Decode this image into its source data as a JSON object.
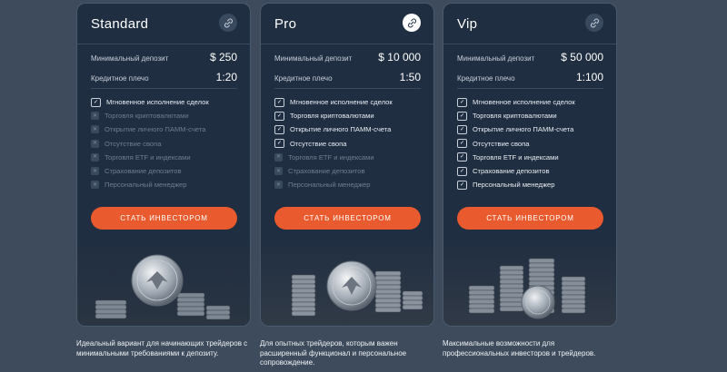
{
  "colors": {
    "accent": "#e95a2e",
    "card": "#1f2e41",
    "page": "#3d4b5c"
  },
  "plans": [
    {
      "name": "Standard",
      "badge_icon": "link-icon",
      "min_deposit_label": "Минимальный депозит",
      "min_deposit": "$ 250",
      "leverage_label": "Кредитное плечо",
      "leverage": "1:20",
      "features": [
        {
          "label": "Мгновенное исполнение сделок",
          "included": true
        },
        {
          "label": "Торговля криптовалютами",
          "included": false
        },
        {
          "label": "Открытие личного ПАММ-счета",
          "included": false
        },
        {
          "label": "Отсутствие свопа",
          "included": false
        },
        {
          "label": "Торговля ETF и индексами",
          "included": false
        },
        {
          "label": "Страхование депозитов",
          "included": false
        },
        {
          "label": "Персональный менеджер",
          "included": false
        }
      ],
      "cta": "СТАТЬ ИНВЕСТОРОМ",
      "description": "Идеальный вариант для начинающих трейдеров с минимальными требованиями к депозиту."
    },
    {
      "name": "Pro",
      "badge_icon": "link-icon",
      "min_deposit_label": "Минимальный депозит",
      "min_deposit": "$ 10 000",
      "leverage_label": "Кредитное плечо",
      "leverage": "1:50",
      "features": [
        {
          "label": "Мгновенное исполнение сделок",
          "included": true
        },
        {
          "label": "Торговля криптовалютами",
          "included": true
        },
        {
          "label": "Открытие личного ПАММ-счета",
          "included": true
        },
        {
          "label": "Отсутствие свопа",
          "included": true
        },
        {
          "label": "Торговля ETF и индексами",
          "included": false
        },
        {
          "label": "Страхование депозитов",
          "included": false
        },
        {
          "label": "Персональный менеджер",
          "included": false
        }
      ],
      "cta": "СТАТЬ ИНВЕСТОРОМ",
      "description": "Для опытных трейдеров, которым важен расширенный функционал и персональное сопровождение."
    },
    {
      "name": "Vip",
      "badge_icon": "link-icon",
      "min_deposit_label": "Минимальный депозит",
      "min_deposit": "$ 50 000",
      "leverage_label": "Кредитное плечо",
      "leverage": "1:100",
      "features": [
        {
          "label": "Мгновенное исполнение сделок",
          "included": true
        },
        {
          "label": "Торговля криптовалютами",
          "included": true
        },
        {
          "label": "Открытие личного ПАММ-счета",
          "included": true
        },
        {
          "label": "Отсутствие свопа",
          "included": true
        },
        {
          "label": "Торговля ETF и индексами",
          "included": true
        },
        {
          "label": "Страхование депозитов",
          "included": true
        },
        {
          "label": "Персональный менеджер",
          "included": true
        }
      ],
      "cta": "СТАТЬ ИНВЕСТОРОМ",
      "description": "Максимальные возможности для профессиональных инвесторов и трейдеров."
    }
  ]
}
